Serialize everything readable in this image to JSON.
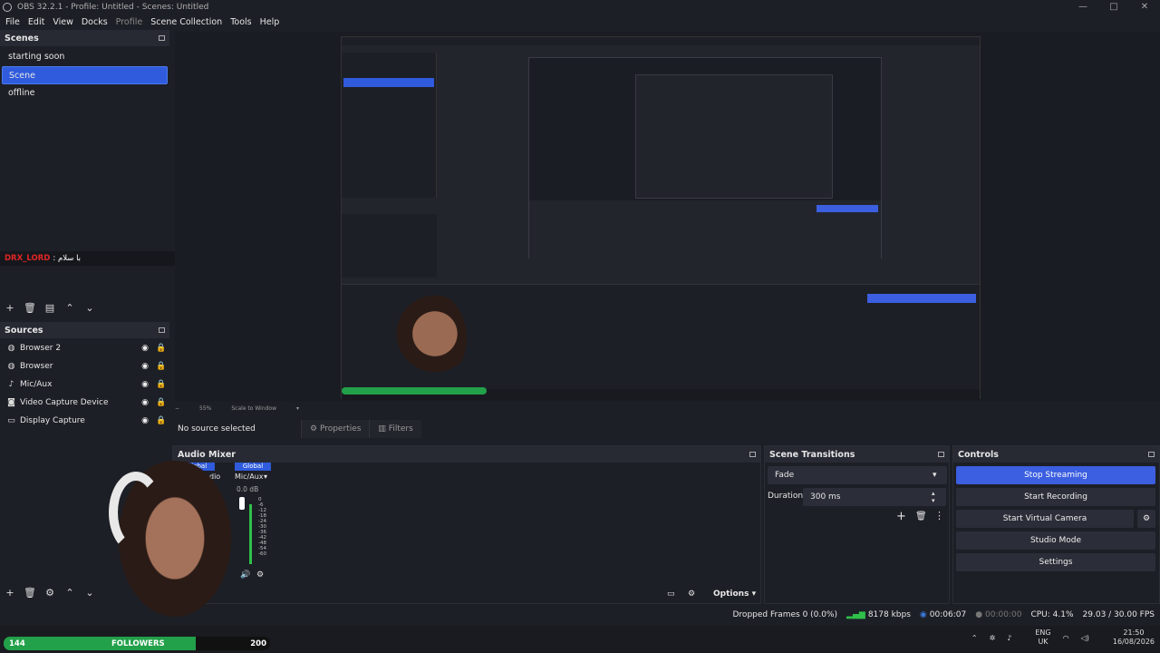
{
  "window": {
    "title": "OBS 32.2.1 - Profile: Untitled - Scenes: Untitled",
    "controls": [
      "—",
      "□",
      "✕"
    ]
  },
  "menu": [
    "File",
    "Edit",
    "View",
    "Docks",
    "Profile",
    "Scene Collection",
    "Tools",
    "Help"
  ],
  "scenes": {
    "header": "Scenes",
    "items": [
      "starting soon",
      "Scene",
      "offline"
    ],
    "selected_index": 1
  },
  "chat_overlay": {
    "user": "DRX_LORD",
    "message": ": با سلام"
  },
  "sources": {
    "header": "Sources",
    "items": [
      {
        "name": "Browser 2",
        "icon": "globe-icon"
      },
      {
        "name": "Browser",
        "icon": "globe-icon"
      },
      {
        "name": "Mic/Aux",
        "icon": "microphone-icon"
      },
      {
        "name": "Video Capture Device",
        "icon": "camera-icon"
      },
      {
        "name": "Display Capture",
        "icon": "monitor-icon"
      }
    ]
  },
  "preview": {
    "zoom": "55%",
    "scale_mode": "Scale to Window"
  },
  "source_toolbar": {
    "no_selection": "No source selected",
    "properties": "Properties",
    "filters": "Filters"
  },
  "audio_mixer": {
    "header": "Audio Mixer",
    "channel_tags": [
      "Global",
      "Global"
    ],
    "channel_label": "Mic/Aux",
    "channel_partial": "dio",
    "volume": "0.0 dB",
    "scale": [
      "0",
      "-6",
      "-12",
      "-18",
      "-24",
      "-30",
      "-36",
      "-42",
      "-48",
      "-54",
      "-60"
    ],
    "options_label": "Options"
  },
  "scene_transitions": {
    "header": "Scene Transitions",
    "transition": "Fade",
    "duration_label": "Duration",
    "duration_value": "300 ms"
  },
  "controls": {
    "header": "Controls",
    "stop_streaming": "Stop Streaming",
    "start_recording": "Start Recording",
    "start_virtual_camera": "Start Virtual Camera",
    "studio_mode": "Studio Mode",
    "settings": "Settings"
  },
  "status": {
    "dropped_frames": "Dropped Frames 0 (0.0%)",
    "bitrate": "8178 kbps",
    "stream_time": "00:06:07",
    "record_time": "00:00:00",
    "cpu": "CPU: 4.1%",
    "fps": "29.03 / 30.00 FPS"
  },
  "followers_bar": {
    "current": "144",
    "label": "FOLLOWERS",
    "goal": "200",
    "progress": 0.72
  },
  "tray": {
    "lang": "ENG",
    "region": "UK",
    "time": "21:50",
    "date": "16/08/2026"
  },
  "colors": {
    "accent": "#2f5bdc",
    "primary_button": "#3b5fe0",
    "chat_user": "#e02626",
    "meter_green": "#2fbf4a",
    "followers_green": "#22a04a"
  }
}
